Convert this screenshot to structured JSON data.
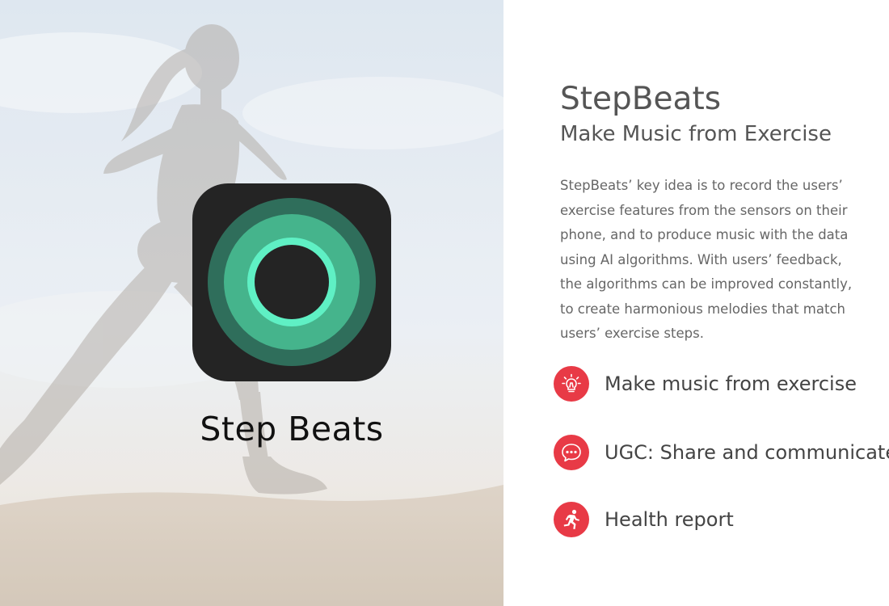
{
  "hero": {
    "brand_name": "Step Beats",
    "app_icon": "concentric-rings-app-icon",
    "background": "runner-silhouette-photo",
    "icon_colors": {
      "tile": "#242424",
      "outer_ring": "#2f6e5b",
      "middle_ring": "#45b48c",
      "inner_ring": "#5ff0c4",
      "core": "#242424"
    }
  },
  "content": {
    "title": "StepBeats",
    "subtitle": "Make Music from Exercise",
    "description_lines": [
      "StepBeats’ key idea is to record the users’",
      "exercise features from the sensors on their",
      "phone, and to produce music with the data",
      "using AI algorithms. With users’ feedback,",
      "the algorithms can be improved constantly,",
      "to create harmonious melodies that match",
      "users’ exercise steps."
    ],
    "features": [
      {
        "icon": "lightbulb-icon",
        "label": "Make music from exercise"
      },
      {
        "icon": "chat-bubble-icon",
        "label": "UGC: Share and communicate"
      },
      {
        "icon": "runner-icon",
        "label": "Health report"
      }
    ],
    "accent_color": "#e83a46"
  }
}
